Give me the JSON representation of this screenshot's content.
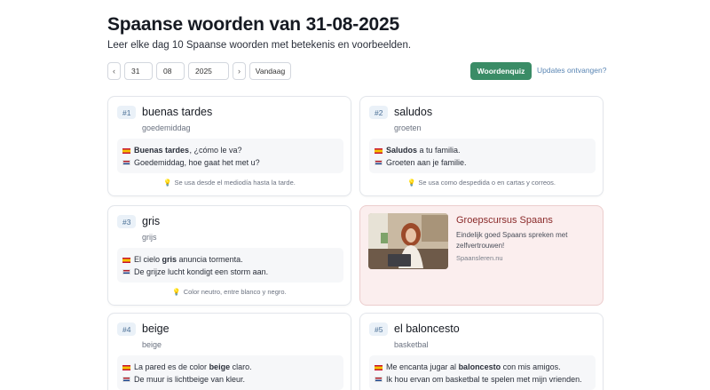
{
  "header": {
    "title": "Spaanse woorden van 31-08-2025",
    "subtitle": "Leer elke dag 10 Spaanse woorden met betekenis en voorbeelden."
  },
  "toolbar": {
    "prev": "‹",
    "day": "31",
    "month": "08",
    "year": "2025",
    "next": "›",
    "today": "Vandaag",
    "quiz": "Woordenquiz",
    "updates": "Updates ontvangen?"
  },
  "words": [
    {
      "num": "#1",
      "word": "buenas tardes",
      "translation": "goedemiddag",
      "es_pre": "",
      "es_bold": "Buenas tardes",
      "es_post": ", ¿cómo le va?",
      "nl": "Goedemiddag, hoe gaat het met u?",
      "tip": "Se usa desde el mediodía hasta la tarde."
    },
    {
      "num": "#2",
      "word": "saludos",
      "translation": "groeten",
      "es_pre": "",
      "es_bold": "Saludos",
      "es_post": "a tu familia.",
      "nl": "Groeten aan je familie.",
      "tip": "Se usa como despedida o en cartas y correos."
    },
    {
      "num": "#3",
      "word": "gris",
      "translation": "grijs",
      "es_pre": "El cielo",
      "es_bold": "gris",
      "es_post": "anuncia tormenta.",
      "nl": "De grijze lucht kondigt een storm aan.",
      "tip": "Color neutro, entre blanco y negro."
    },
    {
      "num": "#4",
      "word": "beige",
      "translation": "beige",
      "es_pre": "La pared es de color",
      "es_bold": "beige",
      "es_post": "claro.",
      "nl": "De muur is lichtbeige van kleur."
    },
    {
      "num": "#5",
      "word_pre": "el",
      "word": "baloncesto",
      "translation": "basketbal",
      "es_pre": "Me encanta jugar al",
      "es_bold": "baloncesto",
      "es_post": "con mis amigos.",
      "nl": "Ik hou ervan om basketbal te spelen met mijn vrienden."
    }
  ],
  "ad": {
    "title": "Groepscursus Spaans",
    "text": "Eindelijk goed Spaans spreken met zelfvertrouwen!",
    "domain": "Spaansleren.nu"
  }
}
